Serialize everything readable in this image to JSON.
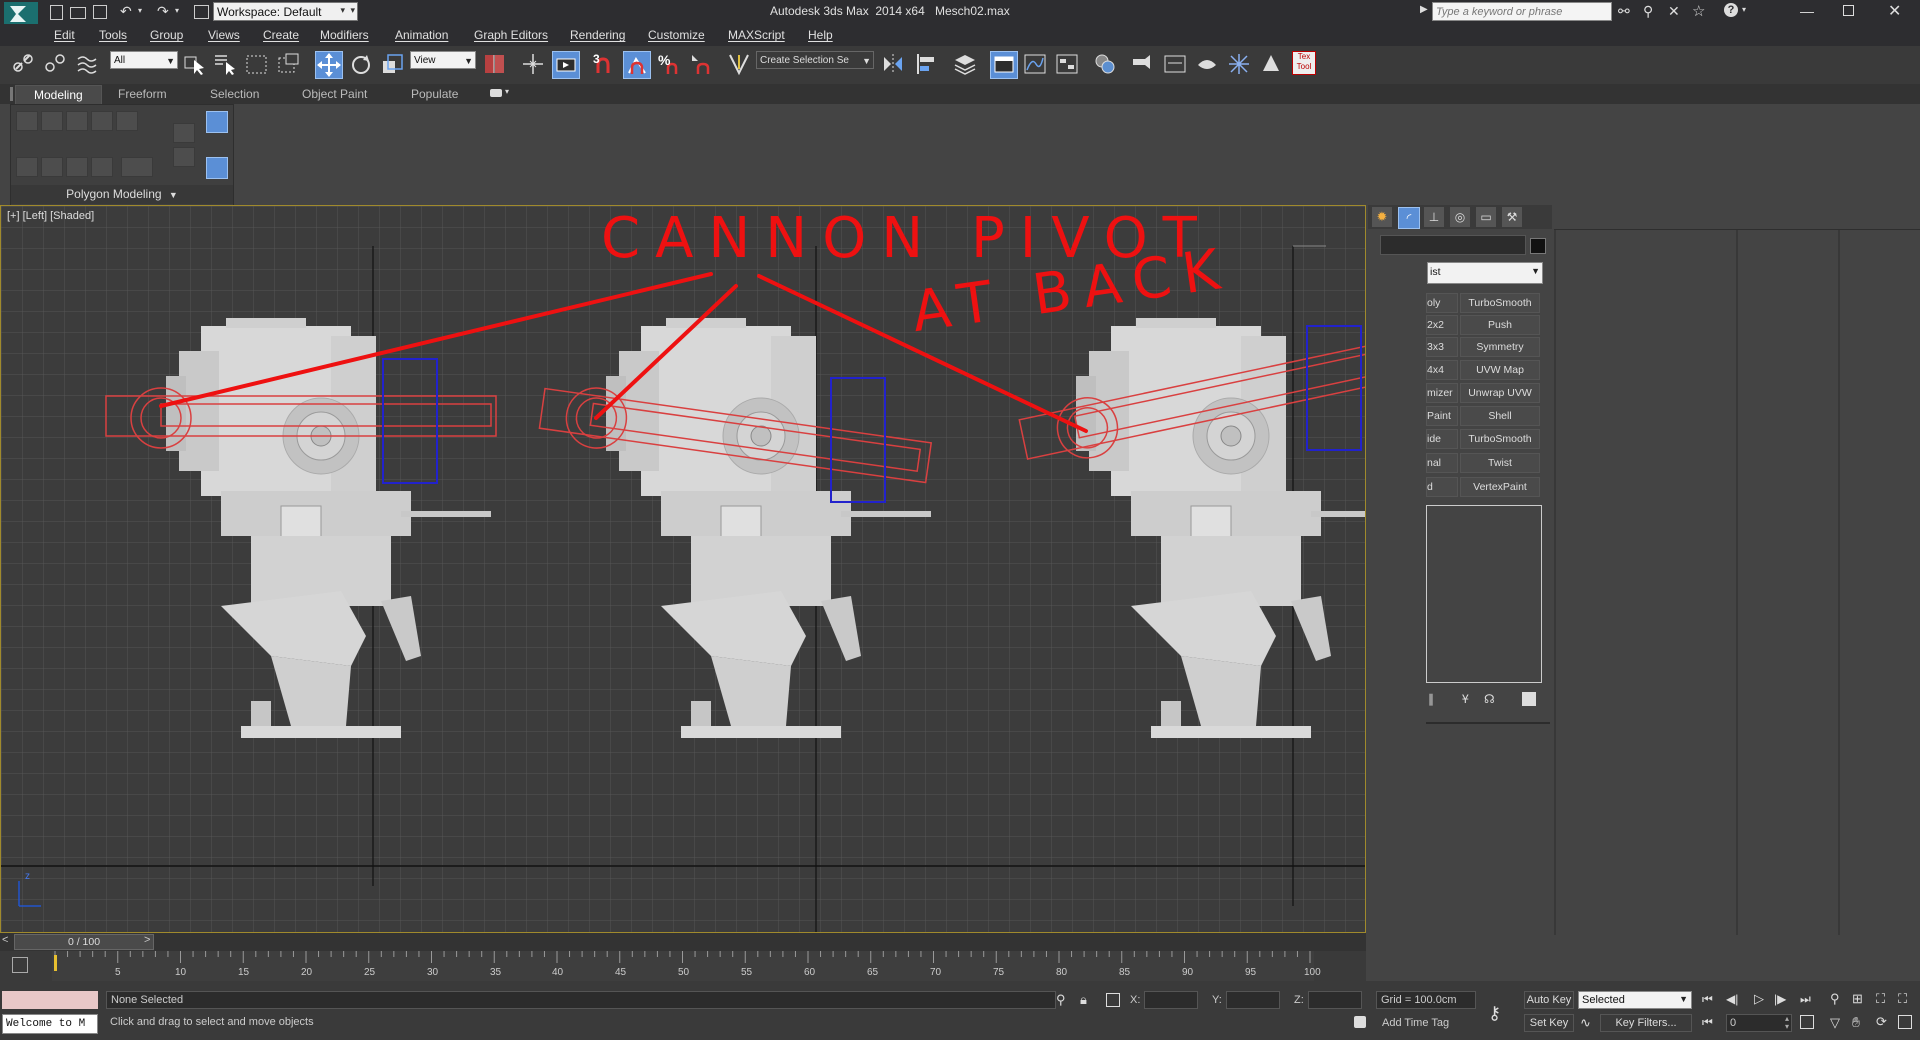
{
  "titlebar": {
    "workspace": "Workspace: Default",
    "app_title": "Autodesk 3ds Max  2014 x64",
    "file_name": "Mesch02.max",
    "search_placeholder": "Type a keyword or phrase"
  },
  "menu": [
    "Edit",
    "Tools",
    "Group",
    "Views",
    "Create",
    "Modifiers",
    "Animation",
    "Graph Editors",
    "Rendering",
    "Customize",
    "MAXScript",
    "Help"
  ],
  "toolbar": {
    "filter_value": "All",
    "refcoord_value": "View",
    "snap_label": "3",
    "angle_snap": "%",
    "selection_set_value": "Create Selection Se"
  },
  "ribbon": {
    "tabs": [
      "Modeling",
      "Freeform",
      "Selection",
      "Object Paint",
      "Populate"
    ],
    "panel_label": "Polygon Modeling"
  },
  "viewport": {
    "label": "[+] [Left] [Shaded]",
    "annotation_line1": "CANNON PIVOT",
    "annotation_line2": "AT BACK",
    "axis_label": "z"
  },
  "command_panel": {
    "list_value": "ist",
    "modifiers_left": [
      "oly",
      "2x2",
      "3x3",
      "4x4",
      "mizer",
      "Paint",
      "ide",
      "nal",
      "d"
    ],
    "modifiers_right": [
      "TurboSmooth",
      "Push",
      "Symmetry",
      "UVW Map",
      "Unwrap UVW",
      "Shell",
      "TurboSmooth",
      "Twist",
      "VertexPaint"
    ]
  },
  "timeline": {
    "frame_display": "0 / 100",
    "ticks": [
      "5",
      "10",
      "15",
      "20",
      "25",
      "30",
      "35",
      "40",
      "45",
      "50",
      "55",
      "60",
      "65",
      "70",
      "75",
      "80",
      "85",
      "90",
      "95",
      "100"
    ]
  },
  "status": {
    "maxscript_text": "Welcome to M",
    "selection_status": "None Selected",
    "prompt": "Click and drag to select and move objects",
    "x_label": "X:",
    "y_label": "Y:",
    "z_label": "Z:",
    "grid": "Grid = 100.0cm",
    "add_time_tag": "Add Time Tag",
    "auto_key": "Auto Key",
    "set_key": "Set Key",
    "key_mode_value": "Selected",
    "key_filters": "Key Filters...",
    "frame_value": "0"
  },
  "colors": {
    "annotation_red": "#ee1111",
    "pivot_blue": "#2222cc",
    "viewport_bg": "#3c3c3c",
    "active_blue": "#5b8fd6"
  }
}
